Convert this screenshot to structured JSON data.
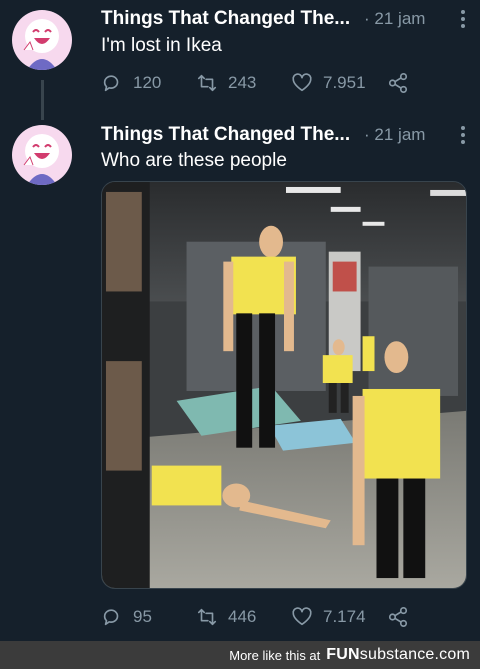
{
  "tweets": [
    {
      "author": "Things That Changed The...",
      "separator": "·",
      "time": "21 jam",
      "text": "I'm lost in Ikea",
      "replies": "120",
      "retweets": "243",
      "likes": "7.951"
    },
    {
      "author": "Things That Changed The...",
      "separator": "·",
      "time": "21 jam",
      "text": "Who are these people",
      "replies": "95",
      "retweets": "446",
      "likes": "7.174"
    }
  ],
  "footer": {
    "text": "More like this at",
    "logo_main": "FUN",
    "logo_sub": "substance",
    "logo_tld": ".com"
  },
  "colors": {
    "background": "#15202b",
    "muted": "#8899a6",
    "footer_bg": "#3b3b3b",
    "shirt": "#f2e250",
    "avatar_bg": "#f7d9ee"
  },
  "icons": {
    "reply": "reply-icon",
    "retweet": "retweet-icon",
    "like": "heart-icon",
    "share": "share-icon",
    "more": "more-options-icon"
  }
}
